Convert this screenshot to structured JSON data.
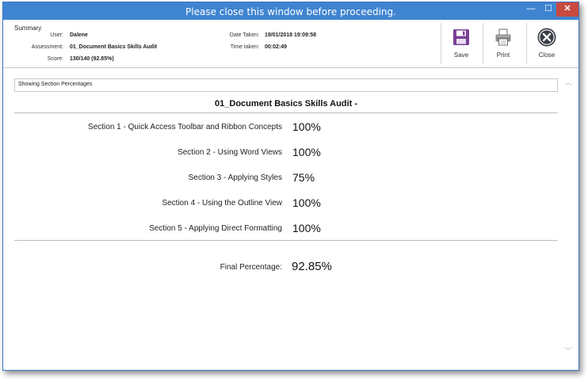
{
  "window": {
    "title": "Please close this window before proceeding."
  },
  "controls": {
    "minimize": "—",
    "maximize": "☐",
    "close": "✕"
  },
  "summary": {
    "heading": "Summary",
    "user_label": "User:",
    "user_value": "Dalene",
    "assessment_label": "Assessment:",
    "assessment_value": "01_Document Basics Skills Audit",
    "score_label": "Score:",
    "score_value": "130/140 (92.85%)",
    "date_label": "Date Taken:",
    "date_value": "19/01/2018 19:09:58",
    "time_label": "Time taken:",
    "time_value": "00:02:49"
  },
  "toolbar": {
    "save_label": "Save",
    "print_label": "Print",
    "close_label": "Close",
    "icons": {
      "save": "save-icon",
      "print": "printer-icon",
      "close": "close-circle-icon"
    }
  },
  "report": {
    "showing_text": "Showing Section Percentages",
    "title": "01_Document Basics Skills Audit -",
    "sections": [
      {
        "label": "Section 1 - Quick Access Toolbar and Ribbon Concepts",
        "pct": "100%"
      },
      {
        "label": "Section 2 - Using Word Views",
        "pct": "100%"
      },
      {
        "label": "Section 3 - Applying Styles",
        "pct": "75%"
      },
      {
        "label": "Section 4 - Using the Outline View",
        "pct": "100%"
      },
      {
        "label": "Section 5 - Applying Direct Formatting",
        "pct": "100%"
      }
    ],
    "final_label": "Final Percentage:",
    "final_pct": "92.85%"
  },
  "scrollbar": {
    "up": "︿",
    "down": "﹀"
  },
  "colors": {
    "titlebar": "#3f84d0",
    "close_button": "#c94a3f",
    "save_icon": "#7a3f9a",
    "close_icon": "#3a3f47"
  }
}
